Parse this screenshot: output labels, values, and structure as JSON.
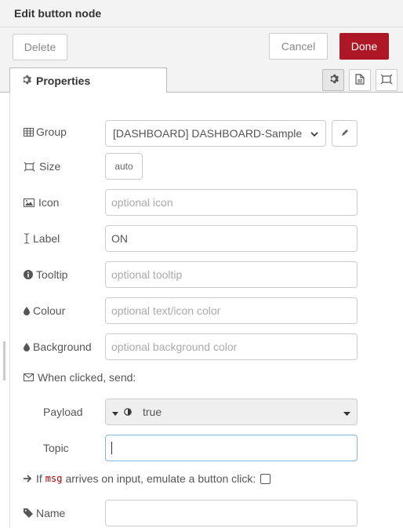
{
  "tray": {
    "title": "Edit button node"
  },
  "toolbar": {
    "delete_label": "Delete",
    "cancel_label": "Cancel",
    "done_label": "Done"
  },
  "tabs": {
    "properties_label": "Properties",
    "icons": [
      "gear-icon",
      "description-icon",
      "appearance-icon"
    ]
  },
  "colors": {
    "done": "#ad1625",
    "header_bg": "#f3f3f3"
  },
  "form": {
    "group": {
      "label": "Group",
      "value": "[DASHBOARD] DASHBOARD-Sample"
    },
    "size": {
      "label": "Size",
      "value": "auto"
    },
    "icon": {
      "label": "Icon",
      "value": "",
      "placeholder": "optional icon"
    },
    "label": {
      "label": "Label",
      "value": "ON"
    },
    "tooltip": {
      "label": "Tooltip",
      "value": "",
      "placeholder": "optional tooltip"
    },
    "colour": {
      "label": "Colour",
      "value": "",
      "placeholder": "optional text/icon color"
    },
    "background": {
      "label": "Background",
      "value": "",
      "placeholder": "optional background color"
    },
    "when_clicked": {
      "label": "When clicked, send:"
    },
    "payload": {
      "label": "Payload",
      "type_icon": "boolean-icon",
      "value": "true"
    },
    "topic": {
      "label": "Topic",
      "value": ""
    },
    "emulate": {
      "prefix": "If",
      "code": "msg",
      "suffix": "arrives on input, emulate a button click:",
      "checked": false
    },
    "name": {
      "label": "Name",
      "value": ""
    }
  }
}
